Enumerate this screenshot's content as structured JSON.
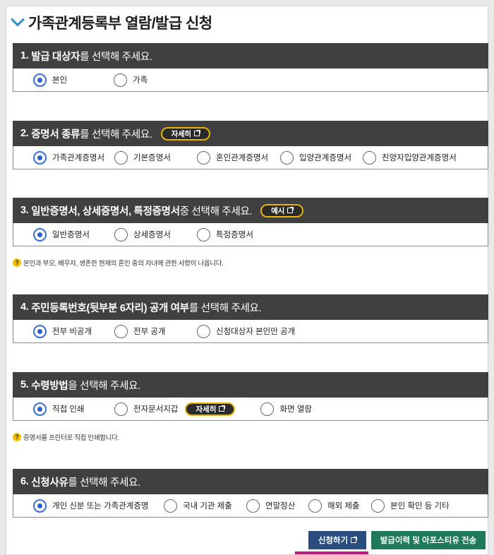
{
  "page": {
    "title": "가족관계등록부 열람/발급 신청"
  },
  "sections": [
    {
      "number": "1.",
      "heading_bold": "발급 대상자",
      "heading_rest": "를 선택해 주세요.",
      "options": [
        "본인",
        "가족"
      ],
      "selected": 0
    },
    {
      "number": "2.",
      "heading_bold": "증명서 종류",
      "heading_rest": "를 선택해 주세요.",
      "pill": "자세히",
      "options": [
        "가족관계증명서",
        "기본증명서",
        "혼인관계증명서",
        "입양관계증명서",
        "친양자입양관계증명서"
      ],
      "selected": 0
    },
    {
      "number": "3.",
      "heading_bold": "일반증명서, 상세증명서, 특정증명서",
      "heading_rest": " 중 선택해 주세요.",
      "pill": "예시",
      "options": [
        "일반증명서",
        "상세증명서",
        "특정증명서"
      ],
      "selected": 0,
      "note": "본인과 부모, 배우자, 생존한 현재의 혼인 중의 자녀에 관한 사항이 나옵니다."
    },
    {
      "number": "4.",
      "heading_bold": "주민등록번호(뒷부분 6자리) 공개 여부",
      "heading_rest": "를 선택해 주세요.",
      "options": [
        "전부 비공개",
        "전부 공개",
        "신청대상자 본인만 공개"
      ],
      "selected": 0
    },
    {
      "number": "5.",
      "heading_bold": "수령방법",
      "heading_rest": "을 선택해 주세요.",
      "options": [
        "직접 인쇄",
        "전자문서지갑",
        "화면 열람"
      ],
      "option_pill": "자세히",
      "selected": 0,
      "note": "증명서를 프린터로 직접 인쇄합니다."
    },
    {
      "number": "6.",
      "heading_bold": "신청사유",
      "heading_rest": "를 선택해 주세요.",
      "options": [
        "개인 신분 또는 가족관계증명",
        "국내 기관 제출",
        "연말정산",
        "해외 제출",
        "본인 확인 등 기타"
      ],
      "selected": 0
    }
  ],
  "buttons": {
    "apply": "신청하기",
    "history": "발급이력 및 아포스티유 전송"
  },
  "colors": {
    "section_header": "#404040",
    "radio_selected": "#2c5fd0",
    "pill_border": "#e8b400",
    "apply_button": "#2b4c7e",
    "history_button": "#1f7a5a",
    "highlight_mark": "#c01a86"
  }
}
